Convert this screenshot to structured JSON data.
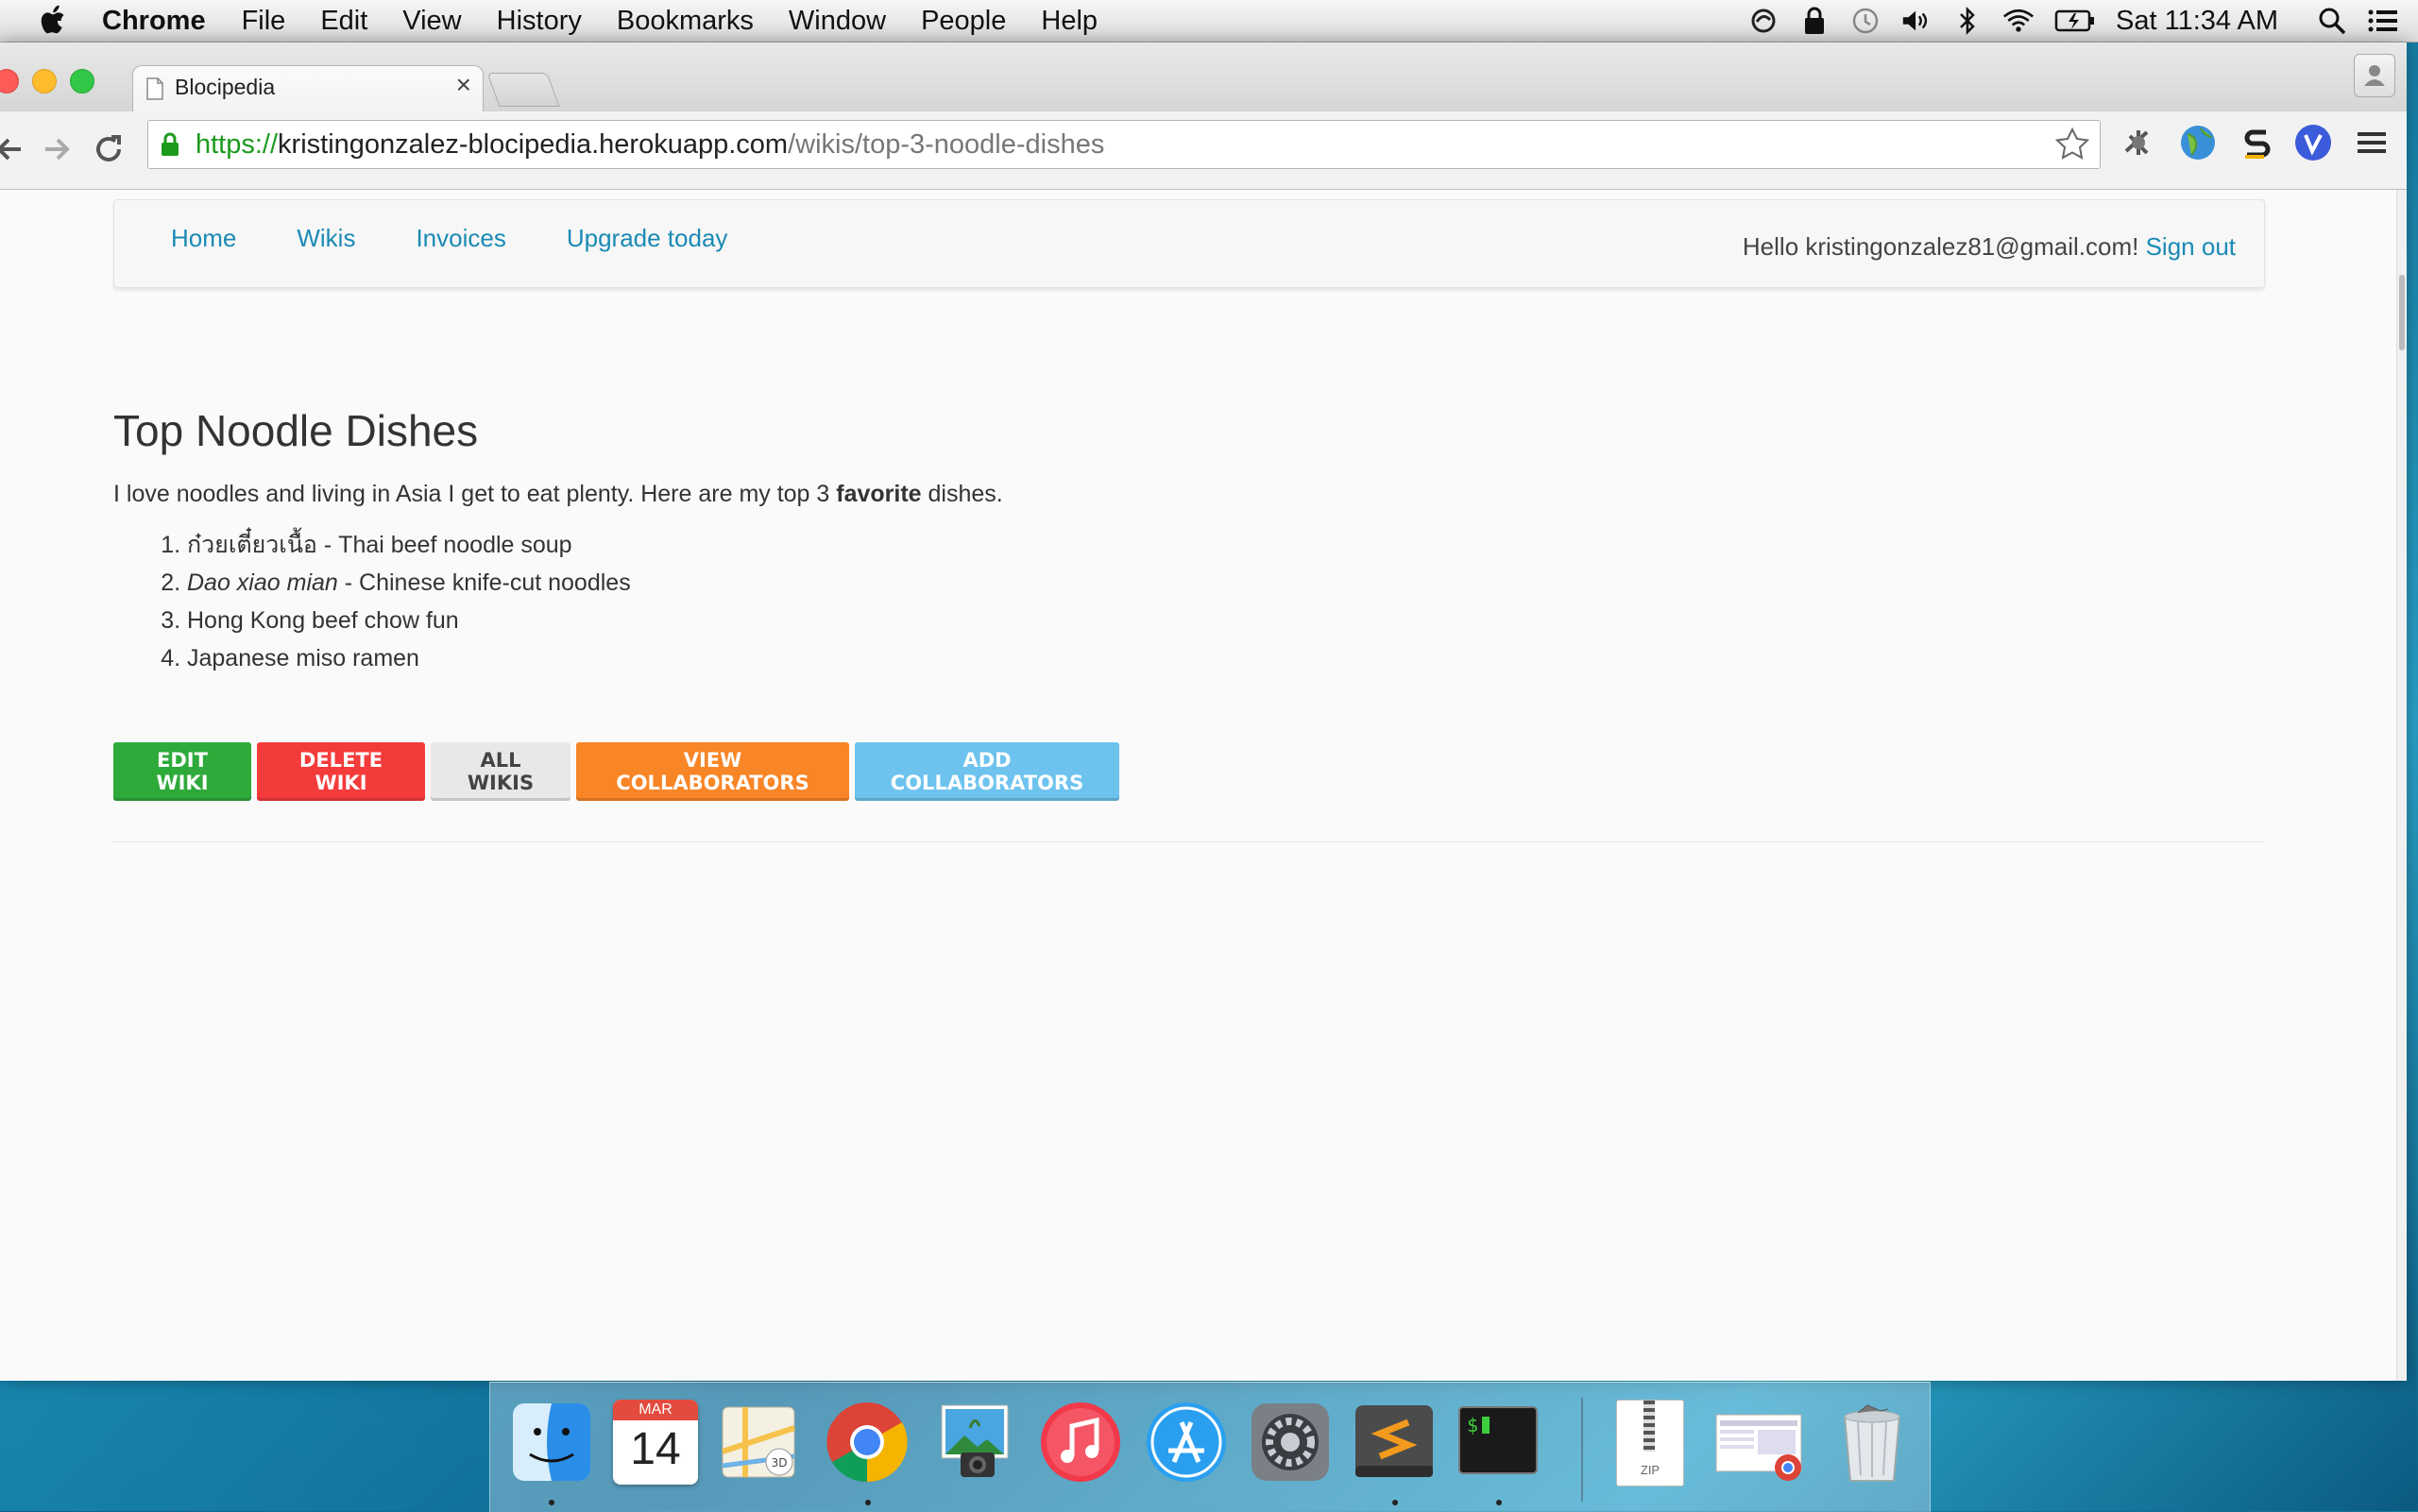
{
  "menubar": {
    "app_name": "Chrome",
    "menus": [
      "File",
      "Edit",
      "View",
      "History",
      "Bookmarks",
      "Window",
      "People",
      "Help"
    ],
    "clock": "Sat 11:34 AM"
  },
  "browser": {
    "tab_title": "Blocipedia",
    "tab_close": "×",
    "url_scheme": "https://",
    "url_host": "kristingonzalez-blocipedia.herokuapp.com",
    "url_path": "/wikis/top-3-noodle-dishes"
  },
  "navbar": {
    "links": [
      "Home",
      "Wikis",
      "Invoices",
      "Upgrade today"
    ],
    "greeting": "Hello kristingonzalez81@gmail.com! ",
    "sign_out": "Sign out"
  },
  "wiki": {
    "title": "Top Noodle Dishes",
    "intro_before": "I love noodles and living in Asia I get to eat plenty. Here are my top 3 ",
    "intro_bold": "favorite",
    "intro_after": " dishes.",
    "dishes": [
      {
        "emphasis": "",
        "main": "ก๋วยเตี๋ยวเนื้อ",
        "rest": " - Thai beef noodle soup"
      },
      {
        "emphasis": "Dao xiao mian",
        "main": "",
        "rest": " - Chinese knife-cut noodles"
      },
      {
        "emphasis": "",
        "main": "",
        "rest": "Hong Kong beef chow fun"
      },
      {
        "emphasis": "",
        "main": "",
        "rest": "Japanese miso ramen"
      }
    ]
  },
  "actions": [
    {
      "label": "EDIT WIKI",
      "color": "#2eaa3a",
      "text": "#ffffff"
    },
    {
      "label": "DELETE WIKI",
      "color": "#f43b3b",
      "text": "#ffffff"
    },
    {
      "label": "ALL WIKIS",
      "color": "#e8e8e8",
      "text": "#444444"
    },
    {
      "label": "VIEW COLLABORATORS",
      "color": "#f88526",
      "text": "#ffffff"
    },
    {
      "label": "ADD COLLABORATORS",
      "color": "#6ec3ee",
      "text": "#ffffff"
    }
  ],
  "dock": {
    "calendar_month": "MAR",
    "calendar_day": "14",
    "archive_label": "ZIP",
    "apps": [
      "finder-icon",
      "calendar-icon",
      "maps-icon",
      "chrome-icon",
      "iphoto-icon",
      "itunes-icon",
      "app-store-icon",
      "system-preferences-icon",
      "sublime-text-icon",
      "terminal-icon"
    ]
  }
}
